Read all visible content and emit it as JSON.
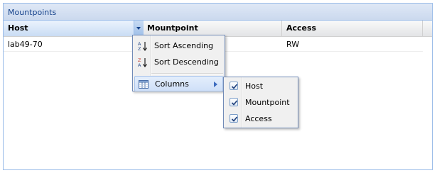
{
  "panel": {
    "title": "Mountpoints"
  },
  "grid": {
    "columns": [
      {
        "label": "Host"
      },
      {
        "label": "Mountpoint"
      },
      {
        "label": "Access"
      }
    ],
    "rows": [
      {
        "host": "lab49-70",
        "mountpoint": "",
        "access": "RW"
      }
    ]
  },
  "column_menu": {
    "sort_asc": "Sort Ascending",
    "sort_desc": "Sort Descending",
    "columns": "Columns"
  },
  "columns_submenu": {
    "items": [
      {
        "label": "Host",
        "checked": true
      },
      {
        "label": "Mountpoint",
        "checked": true
      },
      {
        "label": "Access",
        "checked": true
      }
    ]
  },
  "colors": {
    "header_border": "#99bbe8",
    "title_text": "#15428b",
    "menu_active": "#cfe0f8"
  }
}
